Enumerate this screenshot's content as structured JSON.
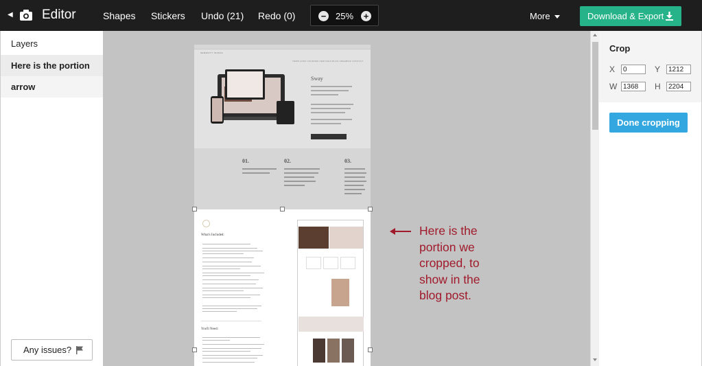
{
  "topbar": {
    "title": "Editor",
    "nav": [
      "Shapes",
      "Stickers",
      "Undo (21)",
      "Redo (0)"
    ],
    "zoom": {
      "minus": "−",
      "value": "25%",
      "plus": "+"
    },
    "more_label": "More",
    "export_label": "Download & Export",
    "icons": {
      "back": "back-arrow-icon",
      "camera": "camera-icon",
      "download": "download-icon",
      "caret": "caret-down-icon"
    }
  },
  "layers": {
    "header": "Layers",
    "items": [
      "Here is the portion",
      "arrow"
    ]
  },
  "issues_label": "Any issues?",
  "canvas": {
    "annotation": "Here is the portion we cropped, to show in the blog post.",
    "annotation_color": "#a01a2b",
    "preview_top": {
      "logo": "SERENITY WINGS",
      "menu": "TEMPLATES  COURSES  SERVICES  BLOG  FREEBIES  CONTACT",
      "title": "Sway",
      "steps": [
        "01.",
        "02.",
        "03."
      ]
    },
    "preview_bottom": {
      "heading1": "What's Included:",
      "heading2": "You'll Need:"
    }
  },
  "crop": {
    "title": "Crop",
    "x_label": "X",
    "x_value": "0",
    "y_label": "Y",
    "y_value": "1212",
    "w_label": "W",
    "w_value": "1368",
    "h_label": "H",
    "h_value": "2204",
    "done_label": "Done cropping"
  },
  "colors": {
    "accent_green": "#27b38a",
    "accent_blue": "#33a8e0",
    "topbar": "#1e1e1e"
  }
}
